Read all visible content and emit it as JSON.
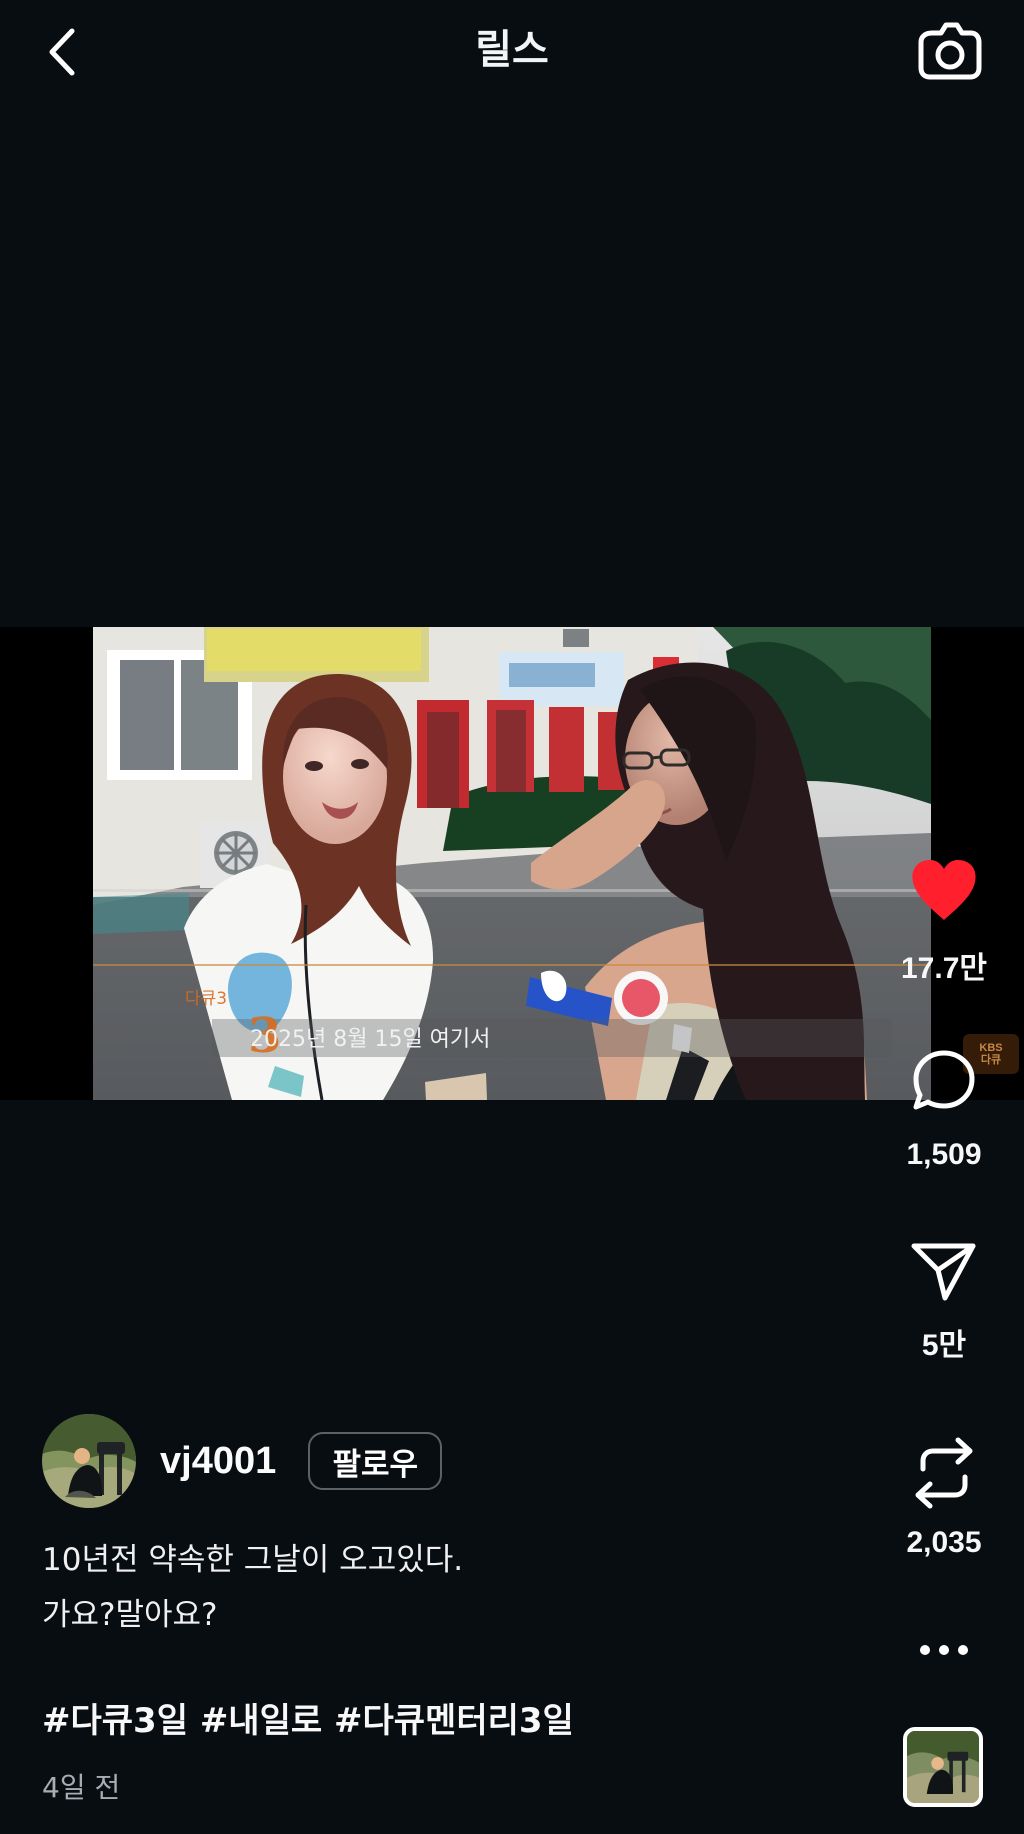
{
  "header": {
    "title": "릴스",
    "back_icon": "chevron-left-icon",
    "camera_icon": "camera-icon"
  },
  "video": {
    "subtitle": "2025년 8월 15일 여기서",
    "program_mark": "다큐3",
    "watermark_top": "KBS",
    "watermark_bottom": "다큐"
  },
  "actions": {
    "likes": "17.7만",
    "comments": "1,509",
    "shares": "5만",
    "reposts": "2,035",
    "like_color": "#ff1f2d"
  },
  "post": {
    "username": "vj4001",
    "follow_label": "팔로우",
    "caption_line_1": "10년전 약속한 그날이 오고있다.",
    "caption_line_2": "가요?말아요?",
    "hashtags": "#다큐3일 #내일로 #다큐멘터리3일",
    "time": "4일 전"
  }
}
